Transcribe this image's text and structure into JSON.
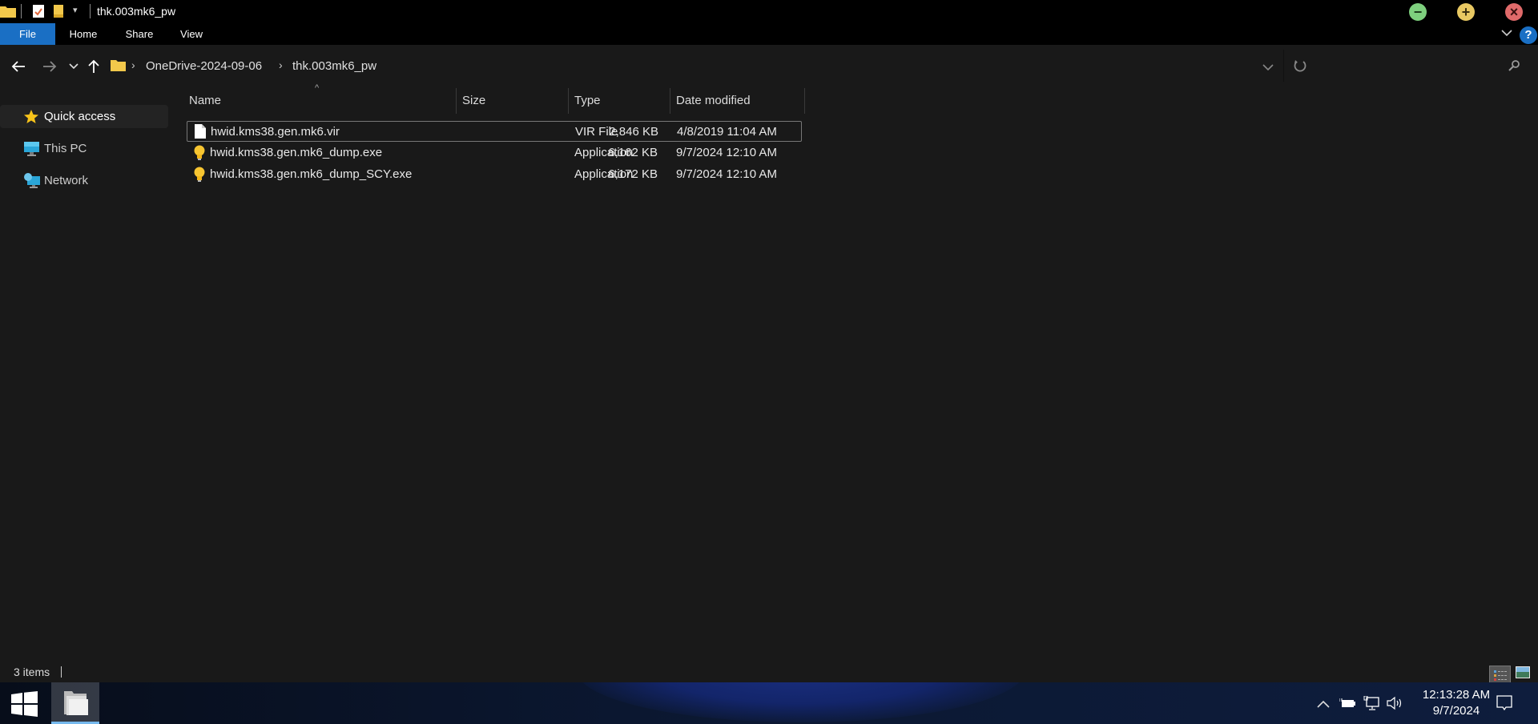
{
  "window": {
    "title": "thk.003mk6_pw",
    "controls": {
      "minimize": "−",
      "maximize": "+",
      "close": "×"
    },
    "colors": {
      "minimize": "#7ed07e",
      "maximize": "#e8c862",
      "close": "#e06a6a",
      "accent": "#1a6fc4"
    }
  },
  "ribbon": {
    "tabs": [
      {
        "label": "File",
        "active": true
      },
      {
        "label": "Home",
        "active": false
      },
      {
        "label": "Share",
        "active": false
      },
      {
        "label": "View",
        "active": false
      }
    ],
    "help": "?"
  },
  "address": {
    "breadcrumbs": [
      "OneDrive-2024-09-06",
      "thk.003mk6_pw"
    ],
    "separator": "›"
  },
  "navpane": {
    "items": [
      {
        "label": "Quick access",
        "icon": "star-icon",
        "selected": true
      },
      {
        "label": "This PC",
        "icon": "computer-icon",
        "selected": false
      },
      {
        "label": "Network",
        "icon": "network-icon",
        "selected": false
      }
    ]
  },
  "filelist": {
    "columns": [
      "Name",
      "Size",
      "Type",
      "Date modified"
    ],
    "sort_indicator": "^",
    "rows": [
      {
        "name": "hwid.kms38.gen.mk6.vir",
        "size": "2,846 KB",
        "type": "VIR File",
        "date": "4/8/2019 11:04 AM",
        "icon": "file-icon",
        "selected": true
      },
      {
        "name": "hwid.kms38.gen.mk6_dump.exe",
        "size": "6,162 KB",
        "type": "Application",
        "date": "9/7/2024 12:10 AM",
        "icon": "lightbulb-icon",
        "selected": false
      },
      {
        "name": "hwid.kms38.gen.mk6_dump_SCY.exe",
        "size": "6,172 KB",
        "type": "Application",
        "date": "9/7/2024 12:10 AM",
        "icon": "lightbulb-icon",
        "selected": false
      }
    ]
  },
  "statusbar": {
    "item_count": "3 items"
  },
  "taskbar": {
    "time": "12:13:28 AM",
    "date": "9/7/2024"
  }
}
